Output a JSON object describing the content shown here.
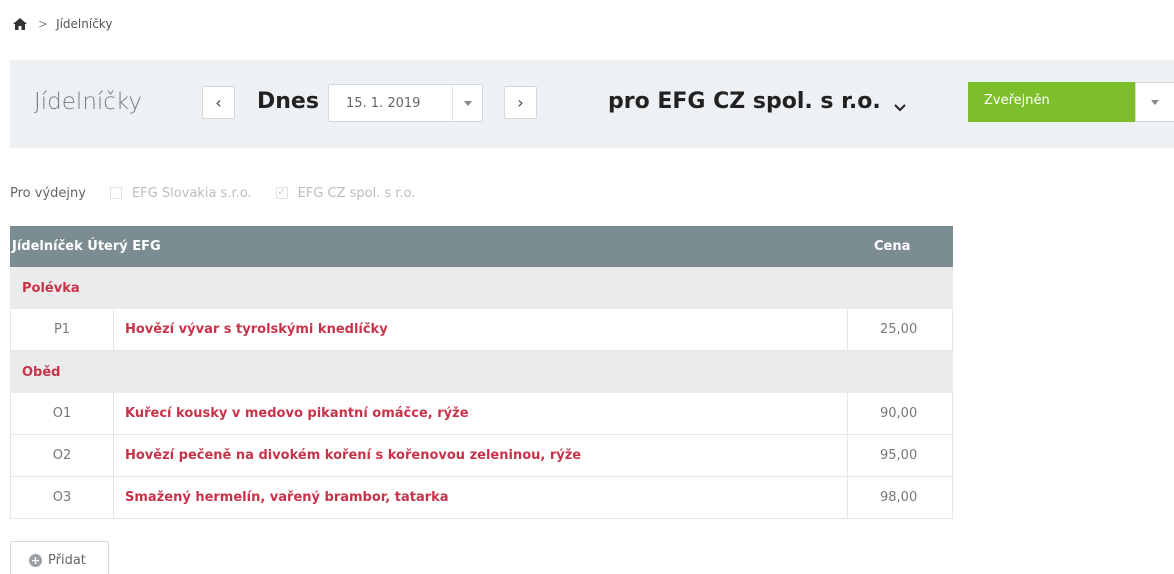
{
  "breadcrumb": {
    "home_icon": "home-icon",
    "separator": ">",
    "current": "Jídelníčky"
  },
  "toolbar": {
    "title": "Jídelníčky",
    "prev_label": "‹",
    "next_label": "›",
    "day_label": "Dnes",
    "date_value": "15. 1. 2019",
    "company": "pro EFG CZ spol. s r.o.",
    "status_label": "Zveřejněn",
    "status_color": "#7cbf2a"
  },
  "outlets": {
    "label": "Pro výdejny",
    "items": [
      {
        "name": "EFG Slovakia s.r.o.",
        "checked": false,
        "mark": ""
      },
      {
        "name": "EFG CZ spol. s r.o.",
        "checked": true,
        "mark": "✓"
      }
    ]
  },
  "menu": {
    "header_title": "Jídelníček Úterý EFG",
    "header_price": "Cena",
    "categories": [
      {
        "name": "Polévka",
        "items": [
          {
            "code": "P1",
            "name": "Hovězí vývar s tyrolskými knedlíčky",
            "price": "25,00"
          }
        ]
      },
      {
        "name": "Oběd",
        "items": [
          {
            "code": "O1",
            "name": "Kuřecí kousky v medovo pikantní omáčce, rýže",
            "price": "90,00"
          },
          {
            "code": "O2",
            "name": "Hovězí pečeně na divokém koření s kořenovou zeleninou, rýže",
            "price": "95,00"
          },
          {
            "code": "O3",
            "name": "Smažený hermelín, vařený brambor, tatarka",
            "price": "98,00"
          }
        ]
      }
    ]
  },
  "add_button_label": "Přidat",
  "accent_red": "#c7344a",
  "header_bg": "#7b8d93"
}
